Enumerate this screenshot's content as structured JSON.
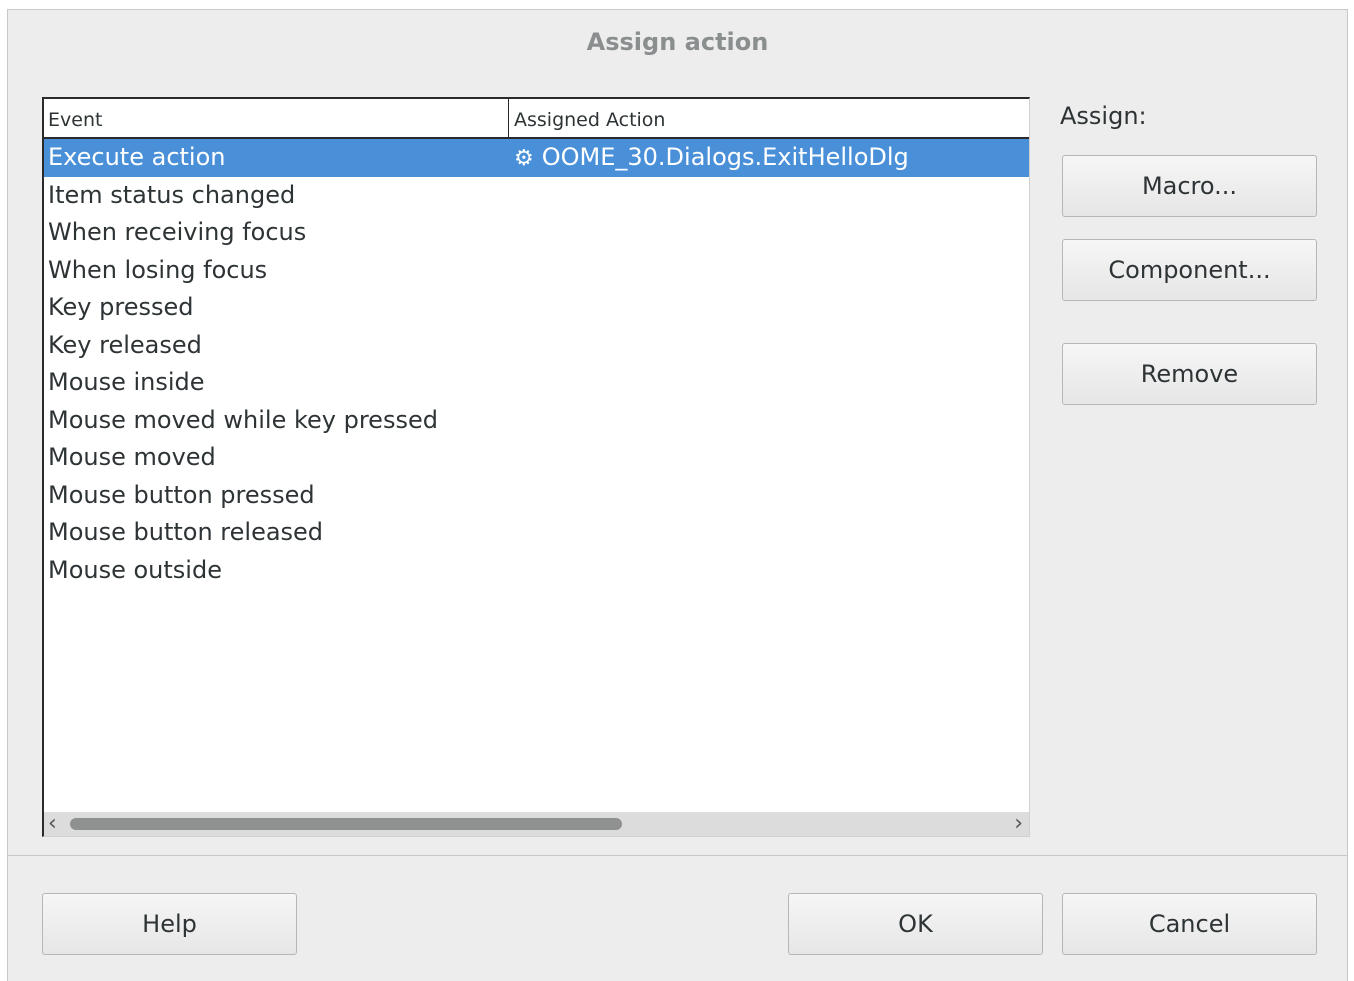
{
  "dialog": {
    "title": "Assign action"
  },
  "events_table": {
    "headers": {
      "event": "Event",
      "assigned_action": "Assigned Action"
    },
    "rows": [
      {
        "event": "Execute action",
        "action": "OOME_30.Dialogs.ExitHelloDlg",
        "selected": true
      },
      {
        "event": "Item status changed",
        "action": ""
      },
      {
        "event": "When receiving focus",
        "action": ""
      },
      {
        "event": "When losing focus",
        "action": ""
      },
      {
        "event": "Key pressed",
        "action": ""
      },
      {
        "event": "Key released",
        "action": ""
      },
      {
        "event": "Mouse inside",
        "action": ""
      },
      {
        "event": "Mouse moved while key pressed",
        "action": ""
      },
      {
        "event": "Mouse moved",
        "action": ""
      },
      {
        "event": "Mouse button pressed",
        "action": ""
      },
      {
        "event": "Mouse button released",
        "action": ""
      },
      {
        "event": "Mouse outside",
        "action": ""
      }
    ],
    "action_icon": "gear-icon"
  },
  "assign": {
    "label": "Assign:",
    "macro_button": "Macro...",
    "component_button": "Component...",
    "remove_button": "Remove"
  },
  "footer": {
    "help_button": "Help",
    "ok_button": "OK",
    "cancel_button": "Cancel"
  },
  "colors": {
    "selection": "#4a90d9",
    "dialog_bg": "#ededed"
  }
}
